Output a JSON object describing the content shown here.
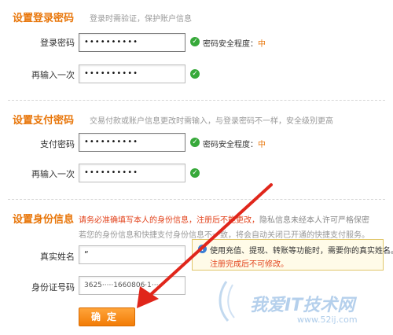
{
  "login_section": {
    "title": "设置登录密码",
    "hint": "登录时需验证，保护账户信息",
    "fields": [
      {
        "label": "登录密码",
        "value": "••••••••••"
      },
      {
        "label": "再输入一次",
        "value": "••••••••••"
      }
    ],
    "strength_label": "密码安全程度：",
    "strength_level": "中"
  },
  "pay_section": {
    "title": "设置支付密码",
    "hint": "交易付款或账户信息更改时需输入，与登录密码不一样，安全级别更高",
    "fields": [
      {
        "label": "支付密码",
        "value": "••••••••••"
      },
      {
        "label": "再输入一次",
        "value": "••••••••••"
      }
    ],
    "strength_label": "密码安全程度：",
    "strength_level": "中"
  },
  "id_section": {
    "title": "设置身份信息",
    "notice_orange": "请务必准确填写本人的身份信息，注册后不能更改，",
    "notice_gray": "隐私信息未经本人许可严格保密",
    "subnotice": "若您的身份信息和快捷支付身份信息不一致，将会自动关闭已开通的快捷支付服务。",
    "name_label": "真实姓名",
    "name_value": "“",
    "id_label": "身份证号码",
    "id_value": "3625·····1660806·1·····",
    "tip_text": "使用充值、提现、转账等功能时，需要你的真实姓名。",
    "tip_red": "注册完成后不可修改。"
  },
  "confirm_label": "确定",
  "watermark": {
    "main": "我爱IT技术网",
    "sub": "www.52ij.com"
  },
  "colors": {
    "accent": "#e8760a",
    "success": "#37a93a",
    "arrow": "#e0261b"
  },
  "icons": {
    "check": "check-circle-icon",
    "info": "info-icon",
    "arrow": "red-arrow-annotation"
  }
}
